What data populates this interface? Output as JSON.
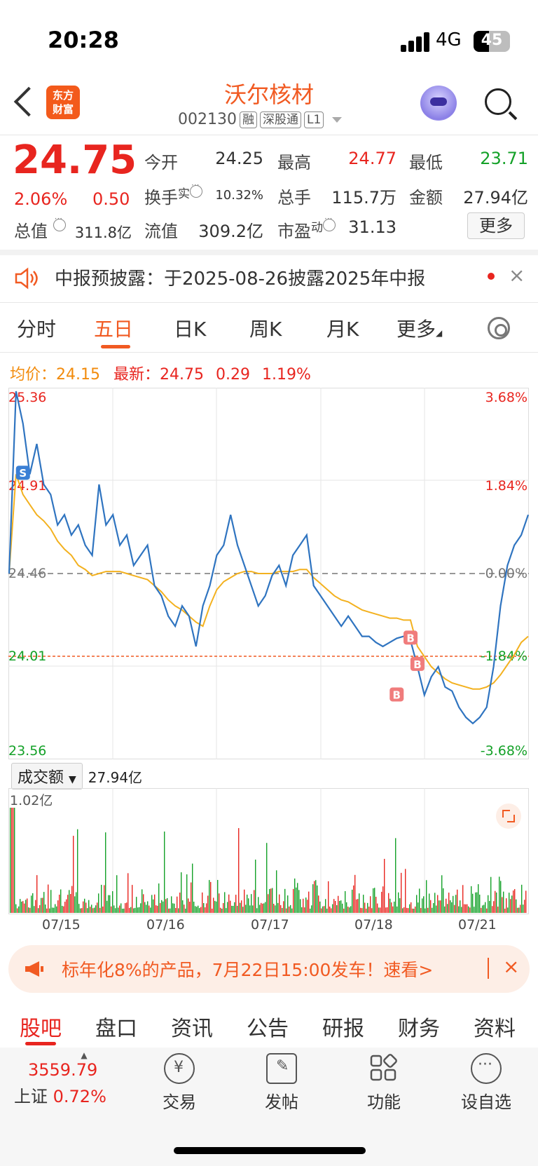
{
  "status": {
    "time": "20:28",
    "network": "4G",
    "battery": "45"
  },
  "header": {
    "logo": "东方\n财富",
    "name": "沃尔核材",
    "code": "002130",
    "tags": [
      "融",
      "深股通",
      "L1"
    ]
  },
  "quote": {
    "price": "24.75",
    "pct": "2.06%",
    "change": "0.50",
    "open_label": "今开",
    "open": "24.25",
    "high_label": "最高",
    "high": "24.77",
    "low_label": "最低",
    "low": "23.71",
    "turnover_label": "换手",
    "turnover_sup": "实",
    "turnover": "10.32%",
    "vol_label": "总手",
    "vol": "115.7万",
    "amount_label": "金额",
    "amount": "27.94亿",
    "mcap_label": "总值",
    "mcap": "311.8亿",
    "float_label": "流值",
    "float": "309.2亿",
    "pe_label": "市盈",
    "pe_sup": "动",
    "pe": "31.13",
    "more": "更多"
  },
  "notice": {
    "text": "中报预披露：于2025-08-26披露2025年中报",
    "close": "×"
  },
  "tabs": [
    "分时",
    "五日",
    "日K",
    "周K",
    "月K",
    "更多"
  ],
  "avg": {
    "avg_label": "均价：",
    "avg": "24.15",
    "latest_label": "最新：",
    "latest": "24.75",
    "chg": "0.29",
    "pct": "1.19%"
  },
  "chart_data": {
    "type": "line",
    "title": "",
    "y_labels_left": [
      "25.36",
      "24.91",
      "24.46",
      "24.01",
      "23.56"
    ],
    "y_labels_right": [
      "3.68%",
      "1.84%",
      "0.00%",
      "-1.84%",
      "-3.68%"
    ],
    "ylim": [
      23.56,
      25.36
    ],
    "x": [
      "07/15",
      "07/16",
      "07/17",
      "07/18",
      "07/21"
    ],
    "reference_price": 24.46,
    "marker_line": 24.01,
    "series": [],
    "price": [
      24.46,
      25.36,
      25.2,
      24.95,
      25.1,
      24.9,
      24.85,
      24.7,
      24.75,
      24.65,
      24.7,
      24.6,
      24.55,
      24.9,
      24.7,
      24.75,
      24.6,
      24.65,
      24.5,
      24.55,
      24.6,
      24.4,
      24.35,
      24.25,
      24.2,
      24.3,
      24.25,
      24.1,
      24.3,
      24.4,
      24.55,
      24.6,
      24.75,
      24.6,
      24.5,
      24.4,
      24.3,
      24.35,
      24.45,
      24.5,
      24.4,
      24.55,
      24.6,
      24.65,
      24.4,
      24.35,
      24.3,
      24.25,
      24.2,
      24.25,
      24.2,
      24.15,
      24.15,
      24.12,
      24.1,
      24.12,
      24.14,
      24.15,
      24.13,
      24.0,
      23.86,
      23.95,
      24.0,
      23.9,
      23.88,
      23.8,
      23.75,
      23.72,
      23.75,
      23.8,
      24.0,
      24.3,
      24.5,
      24.6,
      24.65,
      24.75
    ],
    "avg": [
      24.46,
      24.95,
      24.85,
      24.8,
      24.75,
      24.72,
      24.68,
      24.62,
      24.58,
      24.55,
      24.5,
      24.48,
      24.45,
      24.46,
      24.47,
      24.47,
      24.47,
      24.46,
      24.45,
      24.44,
      24.43,
      24.4,
      24.37,
      24.33,
      24.3,
      24.28,
      24.25,
      24.22,
      24.2,
      24.3,
      24.38,
      24.42,
      24.44,
      24.46,
      24.47,
      24.47,
      24.46,
      24.46,
      24.46,
      24.47,
      24.47,
      24.47,
      24.48,
      24.48,
      24.44,
      24.41,
      24.38,
      24.35,
      24.33,
      24.32,
      24.3,
      24.28,
      24.27,
      24.26,
      24.25,
      24.24,
      24.24,
      24.23,
      24.23,
      24.1,
      24.05,
      24.0,
      23.97,
      23.94,
      23.92,
      23.91,
      23.9,
      23.89,
      23.89,
      23.9,
      23.92,
      23.96,
      24.01,
      24.06,
      24.12,
      24.15
    ],
    "markers": [
      "S",
      "B",
      "B",
      "B"
    ],
    "volume_label": "成交额",
    "volume_total": "27.94亿",
    "volume_max": "1.02亿"
  },
  "ad": {
    "text": "标年化8%的产品，7月22日15:00发车！速看>",
    "close": "×"
  },
  "bottom_tabs": [
    "股吧",
    "盘口",
    "资讯",
    "公告",
    "研报",
    "财务",
    "资料"
  ],
  "footer": {
    "index_value": "3559.79",
    "index_name": "上证",
    "index_pct": "0.72%",
    "items": [
      "交易",
      "发帖",
      "功能",
      "设自选"
    ]
  },
  "colors": {
    "up": "#e8251f",
    "down": "#14a128",
    "brand": "#f15a22",
    "price_line": "#2f74c0",
    "avg_line": "#f3b11f"
  }
}
